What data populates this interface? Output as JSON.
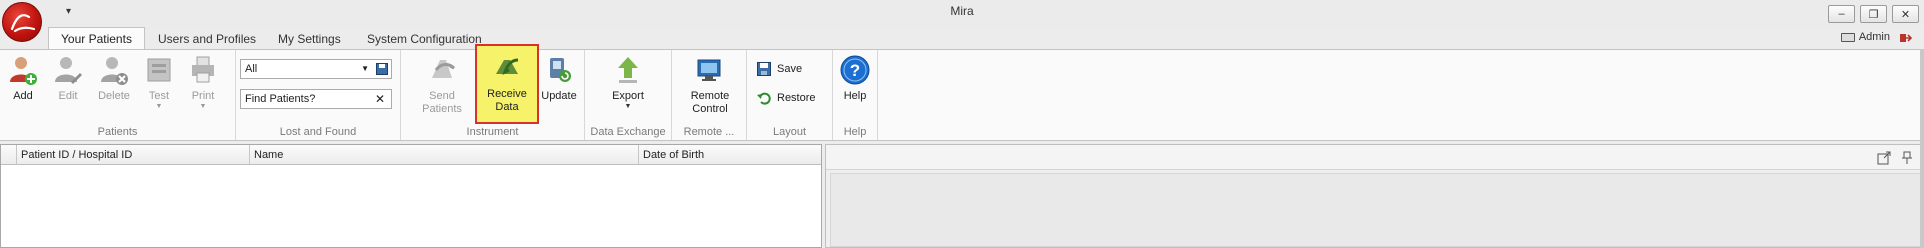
{
  "window": {
    "title": "Mira"
  },
  "tabs": [
    {
      "label": "Your Patients",
      "active": true
    },
    {
      "label": "Users and Profiles",
      "active": false
    },
    {
      "label": "My Settings",
      "active": false
    },
    {
      "label": "System Configuration",
      "active": false
    }
  ],
  "user": {
    "name": "Admin"
  },
  "ribbon": {
    "patients": {
      "label": "Patients",
      "buttons": [
        {
          "label": "Add",
          "icon": "add-patient-icon",
          "enabled": true
        },
        {
          "label": "Edit",
          "icon": "edit-patient-icon",
          "enabled": false
        },
        {
          "label": "Delete",
          "icon": "delete-patient-icon",
          "enabled": false
        },
        {
          "label": "Test",
          "icon": "test-icon",
          "enabled": false
        },
        {
          "label": "Print",
          "icon": "print-icon",
          "enabled": false
        }
      ]
    },
    "lost_found": {
      "label": "Lost and Found",
      "filter_value": "All",
      "search_value": "Find Patients?"
    },
    "instrument": {
      "label": "Instrument",
      "buttons": [
        {
          "label": "Send Patients",
          "icon": "send-patients-icon",
          "enabled": false
        },
        {
          "label": "Receive Data",
          "icon": "receive-data-icon",
          "enabled": true,
          "highlighted": true
        },
        {
          "label": "Update",
          "icon": "update-icon",
          "enabled": true
        }
      ]
    },
    "data_exchange": {
      "label": "Data Exchange",
      "export_label": "Export"
    },
    "remote": {
      "label": "Remote ...",
      "button_label": "Remote Control"
    },
    "layout": {
      "label": "Layout",
      "save_label": "Save",
      "restore_label": "Restore"
    },
    "help": {
      "label": "Help",
      "button_label": "Help"
    }
  },
  "grid": {
    "columns": [
      "Patient ID / Hospital ID",
      "Name",
      "Date of Birth"
    ],
    "rows": []
  },
  "colors": {
    "highlight_fill": "#f6f26a",
    "highlight_border": "#d9322e",
    "accent_blue": "#1c6fd1"
  }
}
